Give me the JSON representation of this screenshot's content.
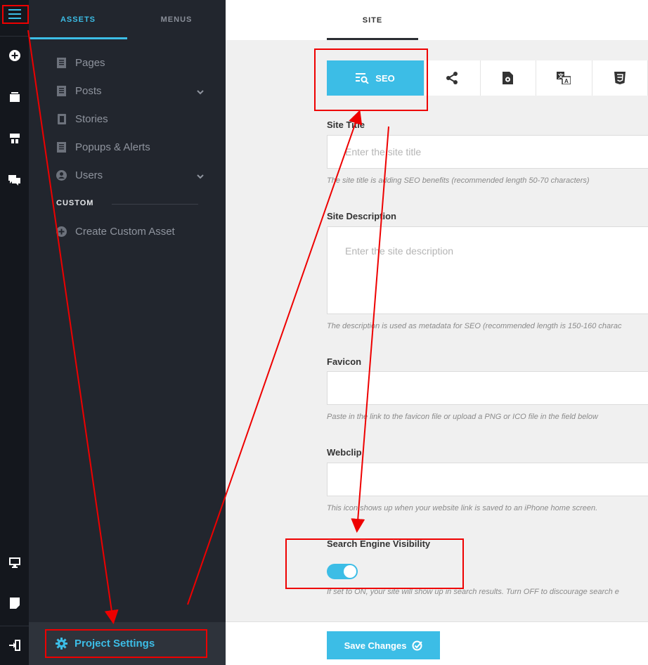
{
  "sidebar_tabs": {
    "assets": "ASSETS",
    "menus": "MENUS"
  },
  "sidebar": {
    "items": [
      {
        "label": "Pages",
        "icon": "page-icon"
      },
      {
        "label": "Posts",
        "icon": "page-icon",
        "has_chevron": true
      },
      {
        "label": "Stories",
        "icon": "story-icon"
      },
      {
        "label": "Popups & Alerts",
        "icon": "page-icon"
      },
      {
        "label": "Users",
        "icon": "user-icon",
        "has_chevron": true
      }
    ],
    "custom_label": "CUSTOM",
    "create_custom": "Create Custom Asset",
    "project_settings": "Project Settings"
  },
  "header": {
    "site_tab": "SITE"
  },
  "icon_bar": {
    "seo_label": "SEO",
    "icons": [
      "share-icon",
      "file-settings-icon",
      "translate-icon",
      "css3-icon"
    ]
  },
  "form": {
    "site_title_label": "Site Title",
    "site_title_placeholder": "Enter the site title",
    "site_title_help": "The site title is adding SEO benefits (recommended length 50-70 characters)",
    "site_desc_label": "Site Description",
    "site_desc_placeholder": "Enter the site description",
    "site_desc_help": "The description is used as metadata for SEO (recommended length is 150-160 charac",
    "favicon_label": "Favicon",
    "favicon_help": "Paste in the link to the favicon file or upload a PNG or ICO file in the field below",
    "webclip_label": "Webclip",
    "webclip_help": "This icon shows up when your website link is saved to an iPhone home screen.",
    "visibility_label": "Search Engine Visibility",
    "visibility_on": true,
    "visibility_help": "If set to ON, your site will show up in search results. Turn OFF to discourage search e"
  },
  "footer": {
    "save_label": "Save Changes"
  },
  "colors": {
    "accent": "#3cbde6",
    "annotation": "#e00000",
    "sidebar_bg": "#22262e",
    "rail_bg": "#14171d"
  }
}
